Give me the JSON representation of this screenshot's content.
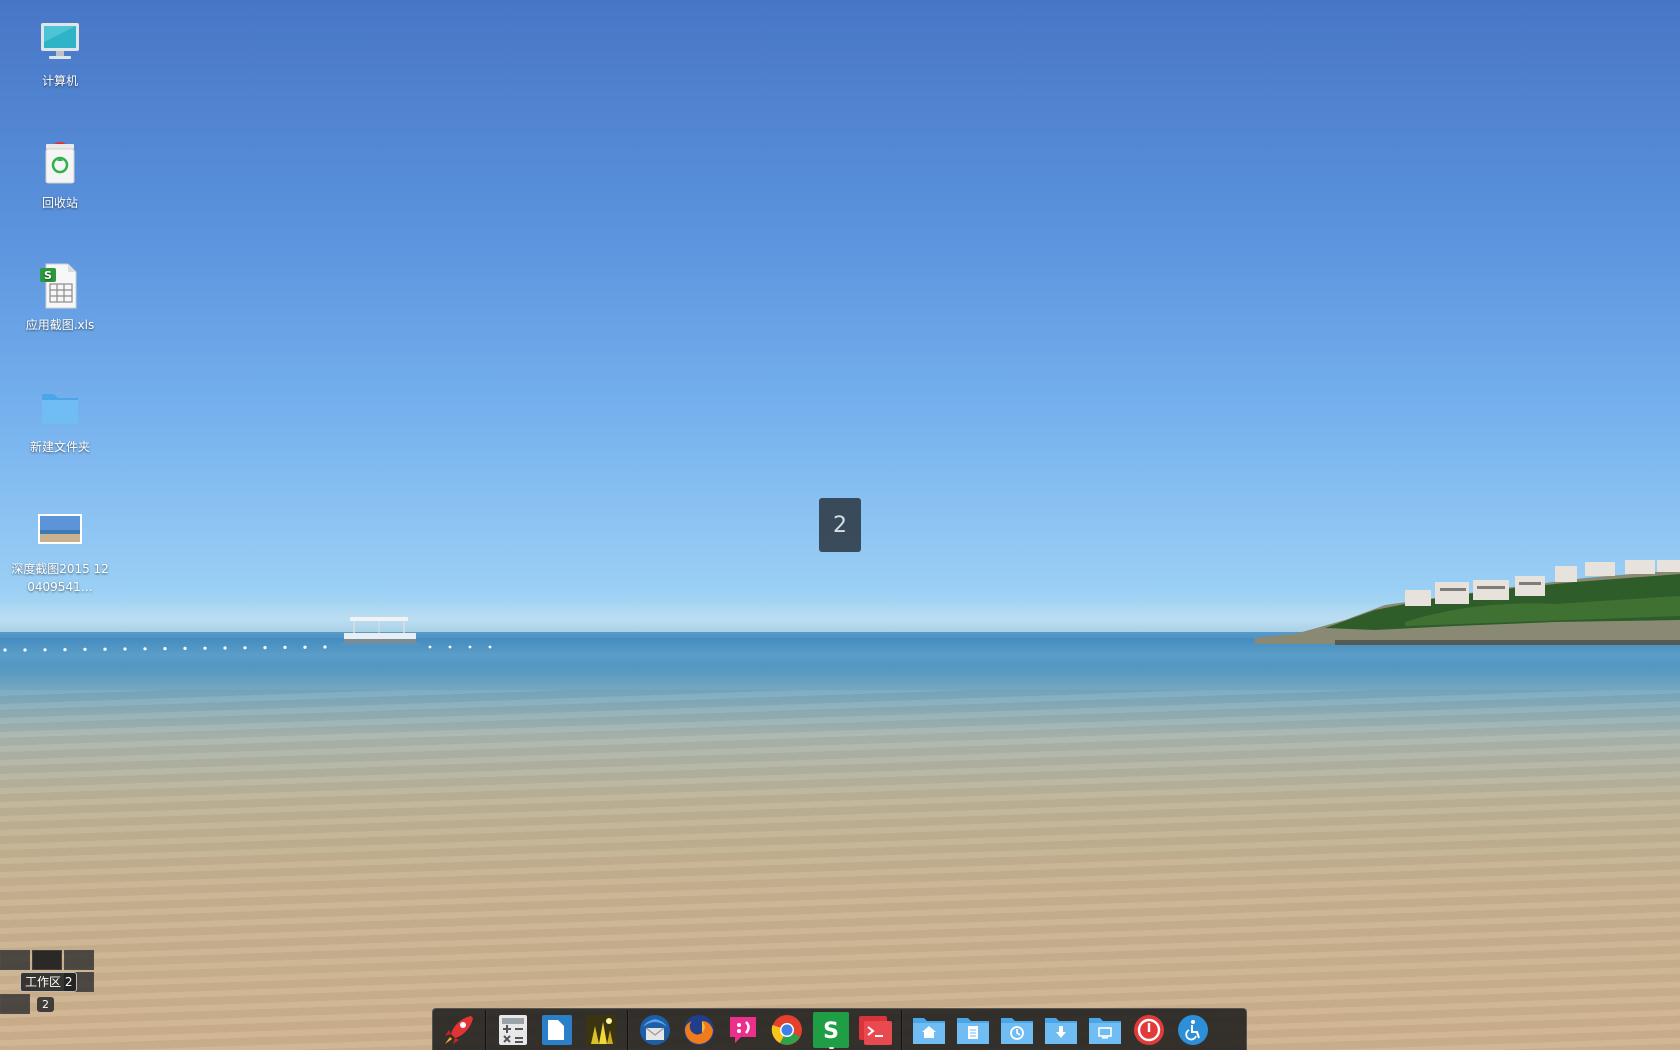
{
  "desktop": {
    "icons": [
      {
        "label": "计算机",
        "icon": "computer-icon"
      },
      {
        "label": "回收站",
        "icon": "trash-icon"
      },
      {
        "label": "应用截图.xls",
        "icon": "spreadsheet-file-icon"
      },
      {
        "label": "新建文件夹",
        "icon": "folder-icon"
      },
      {
        "label": "深度截图2015 120409541…",
        "icon": "image-file-icon"
      }
    ]
  },
  "workspace": {
    "current_number": "2",
    "tooltip": "工作区 2",
    "badge": "2"
  },
  "dock": {
    "apps": [
      {
        "name": "launcher",
        "icon": "rocket-icon"
      },
      {
        "name": "calculator",
        "icon": "calculator-icon"
      },
      {
        "name": "wps-writer",
        "icon": "document-app-icon"
      },
      {
        "name": "image-viewer",
        "icon": "photo-app-icon"
      },
      {
        "name": "thunderbird",
        "icon": "mail-app-icon"
      },
      {
        "name": "firefox",
        "icon": "firefox-icon"
      },
      {
        "name": "chat",
        "icon": "chat-app-icon"
      },
      {
        "name": "chrome",
        "icon": "chrome-icon"
      },
      {
        "name": "wps-spreadsheets",
        "icon": "spreadsheet-app-icon"
      },
      {
        "name": "terminal",
        "icon": "terminal-icon"
      }
    ],
    "places": [
      {
        "name": "home",
        "icon": "home-folder-icon"
      },
      {
        "name": "documents",
        "icon": "documents-folder-icon"
      },
      {
        "name": "recent",
        "icon": "recent-folder-icon"
      },
      {
        "name": "downloads",
        "icon": "downloads-folder-icon"
      },
      {
        "name": "desktop",
        "icon": "desktop-folder-icon"
      },
      {
        "name": "power",
        "icon": "power-icon"
      },
      {
        "name": "accessibility",
        "icon": "accessibility-icon"
      }
    ]
  },
  "colors": {
    "sky_top": "#4776c6",
    "sky_horizon": "#afdaf3",
    "sea": "#4a92c0",
    "sand": "#cfb28e",
    "dock_bg": "#1e1e1e"
  }
}
